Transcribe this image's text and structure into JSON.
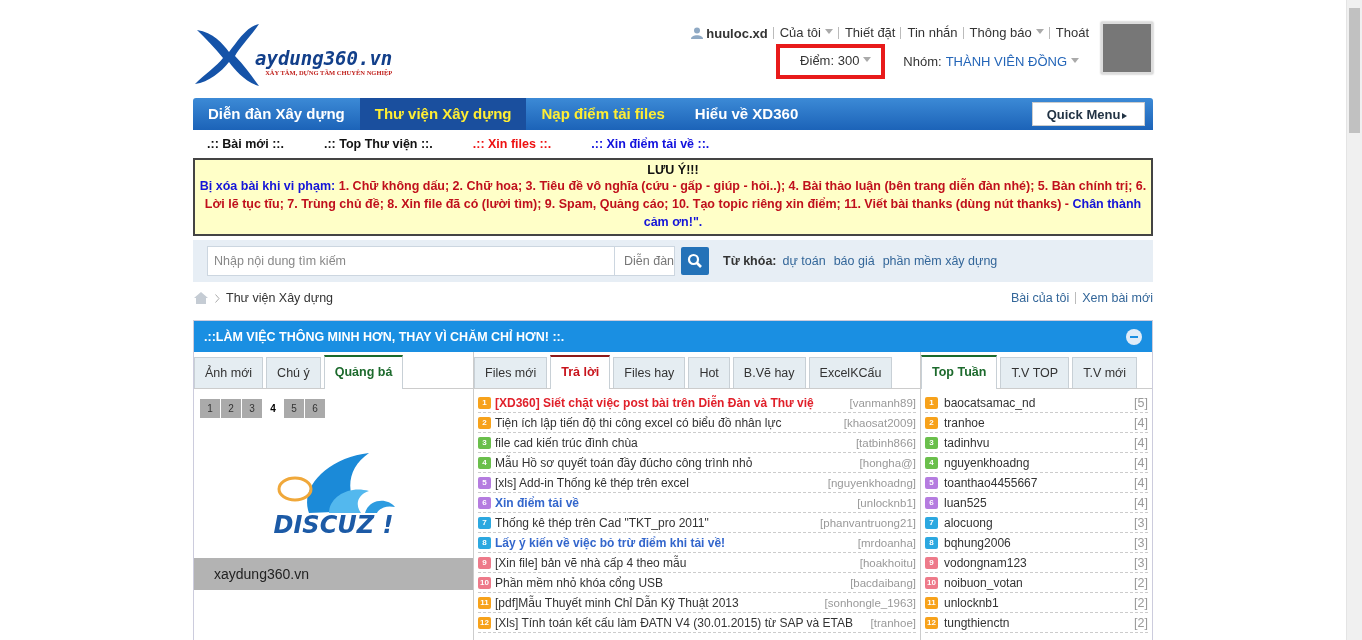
{
  "logo": {
    "name": "aydung360.vn",
    "tagline": "XÂY TÂM, DỰNG TẦM CHUYÊN NGHIỆP"
  },
  "user_bar": {
    "username": "huuloc.xd",
    "links": [
      {
        "label": "Của tôi",
        "dropdown": true
      },
      {
        "label": "Thiết đặt",
        "dropdown": false
      },
      {
        "label": "Tin nhắn",
        "dropdown": false
      },
      {
        "label": "Thông báo",
        "dropdown": true
      },
      {
        "label": "Thoát",
        "dropdown": false
      }
    ],
    "points": {
      "label": "Điểm: 300",
      "highlighted": true
    },
    "group_label": "Nhóm:",
    "group": "THÀNH VIÊN ĐỒNG"
  },
  "nav": {
    "items": [
      {
        "label": "Diễn đàn Xây dựng",
        "selected": false,
        "highlight": false
      },
      {
        "label": "Thư viện Xây dựng",
        "selected": true,
        "highlight": true
      },
      {
        "label": "Nạp điểm tải files",
        "selected": false,
        "highlight": true
      },
      {
        "label": "Hiểu về XD360",
        "selected": false,
        "highlight": false
      }
    ],
    "quick_menu": "Quick Menu"
  },
  "subnav": [
    {
      "label": ".:: Bài mới ::.",
      "color": "#111111"
    },
    {
      "label": ".:: Top Thư viện ::.",
      "color": "#111111"
    },
    {
      "label": ".:: Xin files ::.",
      "color": "#ee1111"
    },
    {
      "label": ".:: Xin điểm tải về ::.",
      "color": "#1111dd"
    }
  ],
  "notice": {
    "title": "LƯU Ý!!!",
    "parts": [
      {
        "kind": "lead",
        "text": "Bị xóa bài khi vi phạm:"
      },
      {
        "kind": "rule",
        "text": " 1. Chữ không dấu; 2. Chữ hoa; 3. Tiêu đề vô nghĩa (cứu - gấp - giúp - hỏi..); 4. Bài thảo luận (bên trang diễn đàn nhé); 5. Bàn chính trị; 6. Lời lẽ tục tĩu; 7. Trùng chủ đề; 8. Xin file đã có (lười tìm); 9. Spam, Quảng cáo; 10. Tạo topic riêng xin điểm; 11. Viết bài thanks (dùng nút thanks) - "
      },
      {
        "kind": "thanks",
        "text": "Chân thành cảm ơn!\"."
      }
    ]
  },
  "search": {
    "placeholder": "Nhập nội dung tìm kiếm",
    "scope": "Diễn đàn",
    "keywords_label": "Từ khóa:",
    "keywords": [
      "dự toán",
      "báo giá",
      "phần mềm xây dựng"
    ]
  },
  "breadcrumb": {
    "current": "Thư viện Xây dựng",
    "links": [
      "Bài của tôi",
      "Xem bài mới"
    ]
  },
  "panel": {
    "title": ".::LÀM VIỆC THÔNG MINH HƠN, THAY VÌ CHĂM CHỈ HƠN! ::.",
    "left": {
      "tabs": [
        {
          "label": "Ảnh mới",
          "selected": false
        },
        {
          "label": "Chú ý",
          "selected": false
        },
        {
          "label": "Quảng bá",
          "selected": true
        }
      ],
      "pages": [
        {
          "label": "1",
          "selected": false
        },
        {
          "label": "2",
          "selected": false
        },
        {
          "label": "3",
          "selected": false
        },
        {
          "label": "4",
          "selected": true
        },
        {
          "label": "5",
          "selected": false
        },
        {
          "label": "6",
          "selected": false
        }
      ],
      "banner_text": "DISCUZ !",
      "caption": "xaydung360.vn"
    },
    "middle": {
      "tabs": [
        {
          "label": "Files mới",
          "selected": false
        },
        {
          "label": "Trả lời",
          "selected": true
        },
        {
          "label": "Files hay",
          "selected": false
        },
        {
          "label": "Hot",
          "selected": false
        },
        {
          "label": "B.Vẽ hay",
          "selected": false
        },
        {
          "label": "ExcelKCấu",
          "selected": false
        }
      ],
      "threads": [
        {
          "number": "1",
          "color": "#f7a21b",
          "kind": "hot",
          "title": "[XD360] Siết chặt việc post bài trên Diễn Đàn và Thư việ",
          "author": "[vanmanh89]"
        },
        {
          "number": "2",
          "color": "#f7a21b",
          "kind": "normal",
          "title": "Tiện ích lập tiến độ thi công excel có biểu đồ nhân lực",
          "author": "[khaosat2009]"
        },
        {
          "number": "3",
          "color": "#6abf4b",
          "kind": "normal",
          "title": "file cad kiến trúc đình chùa",
          "author": "[tatbinh866]"
        },
        {
          "number": "4",
          "color": "#6abf4b",
          "kind": "normal",
          "title": "Mẫu Hồ sơ quyết toán đầy đúcho công trình nhỏ",
          "author": "[hongha@]"
        },
        {
          "number": "5",
          "color": "#b57ce0",
          "kind": "normal",
          "title": "[xls] Add-in Thống kê thép trên excel",
          "author": "[nguyenkhoadng]"
        },
        {
          "number": "6",
          "color": "#b57ce0",
          "kind": "bold",
          "title": "Xin điểm tải về",
          "author": "[unlocknb1]"
        },
        {
          "number": "7",
          "color": "#2ca8e0",
          "kind": "normal",
          "title": "Thống kê thép trên Cad \"TKT_pro 2011\"",
          "author": "[phanvantruong21]"
        },
        {
          "number": "8",
          "color": "#2ca8e0",
          "kind": "bold",
          "title": "Lấy ý kiến về việc bỏ trừ điểm khi tải về!",
          "author": "[mrdoanha]"
        },
        {
          "number": "9",
          "color": "#ee7a8a",
          "kind": "normal",
          "title": "[Xin file] bản vẽ nhà cấp 4 theo mẫu",
          "author": "[hoakhoitu]"
        },
        {
          "number": "10",
          "color": "#ee7a8a",
          "kind": "normal",
          "title": "Phần mềm nhỏ khóa cổng USB",
          "author": "[bacdaibang]"
        },
        {
          "number": "11",
          "color": "#f7a21b",
          "kind": "normal",
          "title": "[pdf]Mẫu Thuyết minh Chỉ Dẫn Kỹ Thuật 2013",
          "author": "[sonhongle_1963]"
        },
        {
          "number": "12",
          "color": "#f7a21b",
          "kind": "normal",
          "title": "[Xls] Tính toán kết cấu làm ĐATN V4 (30.01.2015) từ SAP và ETAB",
          "author": "[tranhoe]"
        }
      ]
    },
    "right": {
      "tabs": [
        {
          "label": "Top Tuần",
          "selected": true
        },
        {
          "label": "T.V TOP",
          "selected": false
        },
        {
          "label": "T.V mới",
          "selected": false
        }
      ],
      "users": [
        {
          "number": "1",
          "color": "#f7a21b",
          "name": "baocatsamac_nd",
          "count": "[5]"
        },
        {
          "number": "2",
          "color": "#f7a21b",
          "name": "tranhoe",
          "count": "[4]"
        },
        {
          "number": "3",
          "color": "#6abf4b",
          "name": "tadinhvu",
          "count": "[4]"
        },
        {
          "number": "4",
          "color": "#6abf4b",
          "name": "nguyenkhoadng",
          "count": "[4]"
        },
        {
          "number": "5",
          "color": "#b57ce0",
          "name": "toanthao4455667",
          "count": "[4]"
        },
        {
          "number": "6",
          "color": "#b57ce0",
          "name": "luan525",
          "count": "[4]"
        },
        {
          "number": "7",
          "color": "#2ca8e0",
          "name": "alocuong",
          "count": "[3]"
        },
        {
          "number": "8",
          "color": "#2ca8e0",
          "name": "bqhung2006",
          "count": "[3]"
        },
        {
          "number": "9",
          "color": "#ee7a8a",
          "name": "vodongnam123",
          "count": "[3]"
        },
        {
          "number": "10",
          "color": "#ee7a8a",
          "name": "noibuon_votan",
          "count": "[2]"
        },
        {
          "number": "11",
          "color": "#f7a21b",
          "name": "unlocknb1",
          "count": "[2]"
        },
        {
          "number": "12",
          "color": "#f7a21b",
          "name": "tungthienctn",
          "count": "[2]"
        }
      ]
    }
  }
}
